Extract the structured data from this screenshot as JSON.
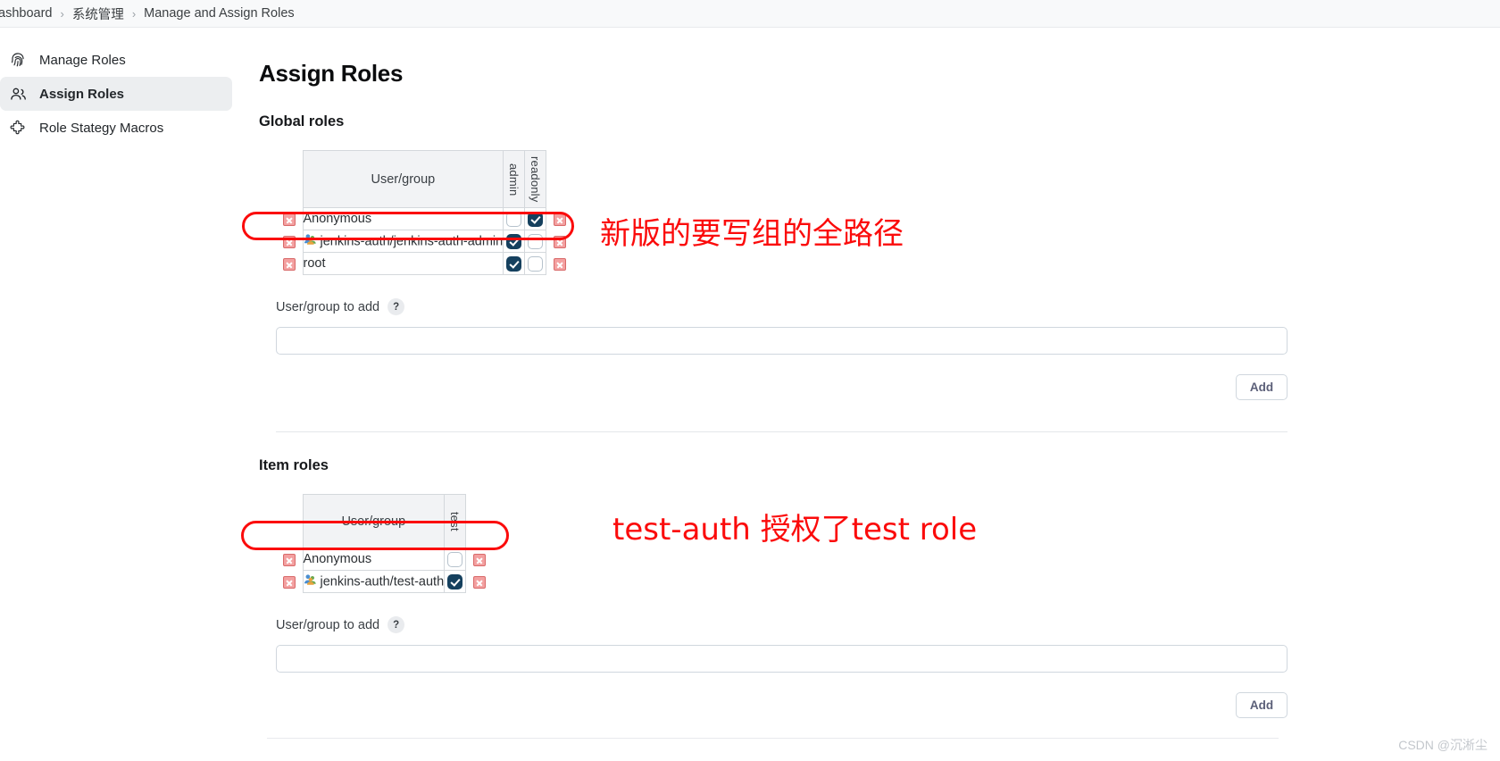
{
  "breadcrumb": {
    "items": [
      "ashboard",
      "系统管理",
      "Manage and Assign Roles"
    ],
    "separator": "›"
  },
  "sidebar": {
    "items": [
      {
        "label": "Manage Roles",
        "icon": "fingerprint-icon",
        "active": false
      },
      {
        "label": "Assign Roles",
        "icon": "people-icon",
        "active": true
      },
      {
        "label": "Role Stategy Macros",
        "icon": "puzzle-icon",
        "active": false
      }
    ]
  },
  "main": {
    "title": "Assign Roles",
    "sections": [
      {
        "id": "global",
        "title": "Global roles",
        "table": {
          "user_group_header": "User/group",
          "role_columns": [
            "admin",
            "readonly"
          ],
          "rows": [
            {
              "name": "Anonymous",
              "is_group": false,
              "checks": [
                false,
                true
              ]
            },
            {
              "name": "jenkins-auth/jenkins-auth-admin",
              "is_group": true,
              "checks": [
                true,
                false
              ]
            },
            {
              "name": "root",
              "is_group": false,
              "checks": [
                true,
                false
              ]
            }
          ]
        },
        "add": {
          "label": "User/group to add",
          "help": "?",
          "value": "",
          "placeholder": "",
          "button": "Add"
        }
      },
      {
        "id": "item",
        "title": "Item roles",
        "table": {
          "user_group_header": "User/group",
          "role_columns": [
            "test"
          ],
          "rows": [
            {
              "name": "Anonymous",
              "is_group": false,
              "checks": [
                false
              ]
            },
            {
              "name": "jenkins-auth/test-auth",
              "is_group": true,
              "checks": [
                true
              ]
            }
          ]
        },
        "add": {
          "label": "User/group to add",
          "help": "?",
          "value": "",
          "placeholder": "",
          "button": "Add"
        }
      }
    ]
  },
  "annotations": [
    {
      "id": "global-note",
      "text": "新版的要写组的全路径"
    },
    {
      "id": "item-note",
      "text": "test-auth 授权了test role"
    }
  ],
  "watermark": "CSDN @沉淅尘",
  "colors": {
    "annotation_red": "#fb0b0b",
    "checkbox_on": "#15405e",
    "sidebar_active_bg": "#eceef0"
  }
}
